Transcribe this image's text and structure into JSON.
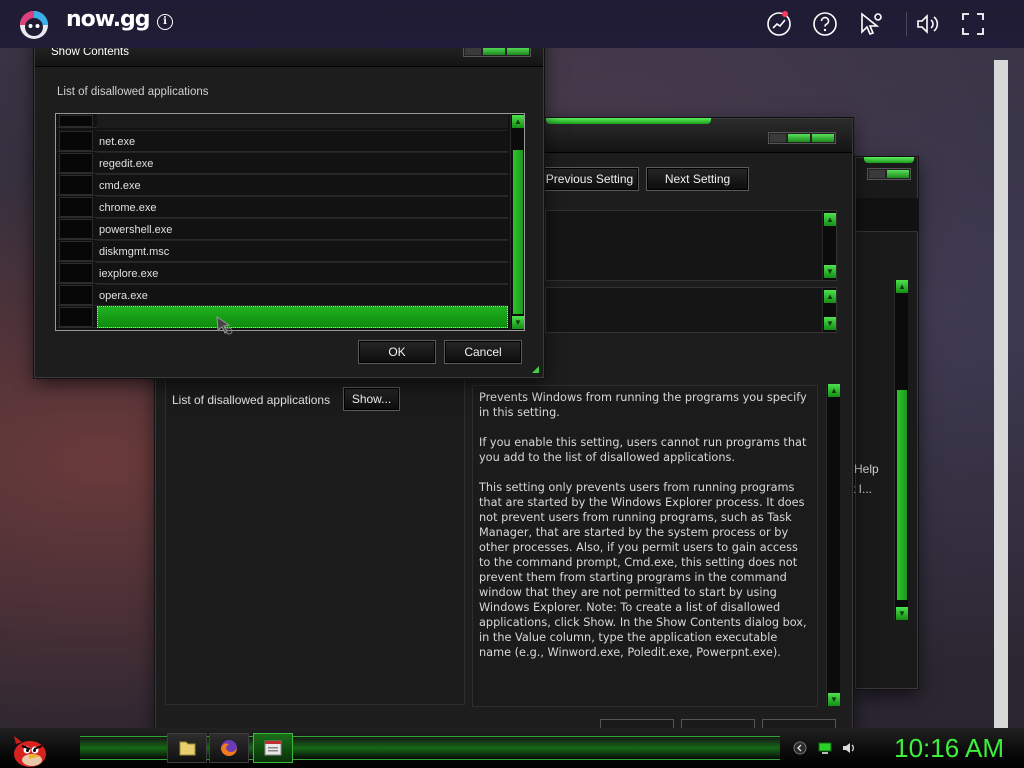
{
  "topbar": {
    "brand": "now.gg",
    "info_glyph": "i",
    "icons": [
      "trending-up-icon",
      "help-icon",
      "cursor-settings-icon",
      "volume-icon",
      "fullscreen-icon"
    ]
  },
  "dialog": {
    "title": "Show Contents",
    "label": "List of disallowed applications",
    "rows": [
      {
        "value": "net.exe"
      },
      {
        "value": "regedit.exe"
      },
      {
        "value": "cmd.exe"
      },
      {
        "value": "chrome.exe"
      },
      {
        "value": "powershell.exe"
      },
      {
        "value": "diskmgmt.msc"
      },
      {
        "value": "iexplore.exe"
      },
      {
        "value": "opera.exe"
      },
      {
        "value": ""
      }
    ],
    "ok_label": "OK",
    "cancel_label": "Cancel"
  },
  "policy_window": {
    "prev_label": "Previous Setting",
    "next_label": "Next Setting",
    "option_label": "List of disallowed applications",
    "show_label": "Show...",
    "help_text": "Prevents Windows from running the programs you specify in this setting.\n\nIf you enable this setting, users cannot run programs that you add to the list of disallowed applications.\n\nThis setting only prevents users from running programs that are started by the Windows Explorer process. It does not prevent users from running programs, such as Task Manager, that are started by the system process or by other processes. Also, if you permit users to gain access to the command prompt, Cmd.exe, this setting does not prevent them from starting programs in the command window that they are not permitted to start by using Windows Explorer. Note: To create a list of disallowed applications, click Show. In the Show Contents dialog box, in the Value column, type the application executable name (e.g., Winword.exe, Poledit.exe, Powerpnt.exe)."
  },
  "back_window": {
    "fragment_1": "Help",
    "fragment_2": "t I..."
  },
  "taskbar": {
    "clock": "10:16 AM",
    "accent": "#3df03d"
  }
}
